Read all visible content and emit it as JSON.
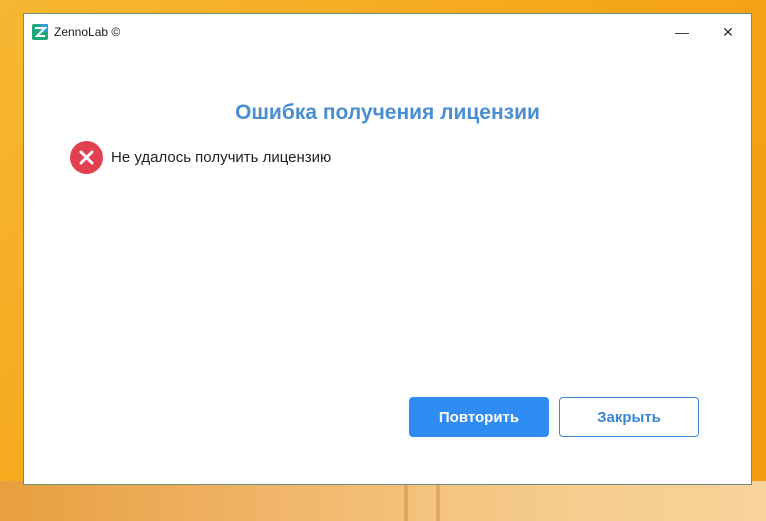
{
  "window": {
    "title": "ZennoLab ©",
    "minimize_glyph": "—",
    "close_glyph": "✕"
  },
  "dialog": {
    "title": "Ошибка получения лицензии",
    "error_message": "Не удалось получить лицензию",
    "retry_label": "Повторить",
    "close_label": "Закрыть"
  },
  "icons": {
    "app": "zennolab-logo-icon",
    "error": "error-circle-x-icon"
  },
  "colors": {
    "title_accent": "#4a8ed2",
    "error": "#e04050",
    "primary_button": "#2e8cf3",
    "desktop_background": "#f5a415"
  }
}
